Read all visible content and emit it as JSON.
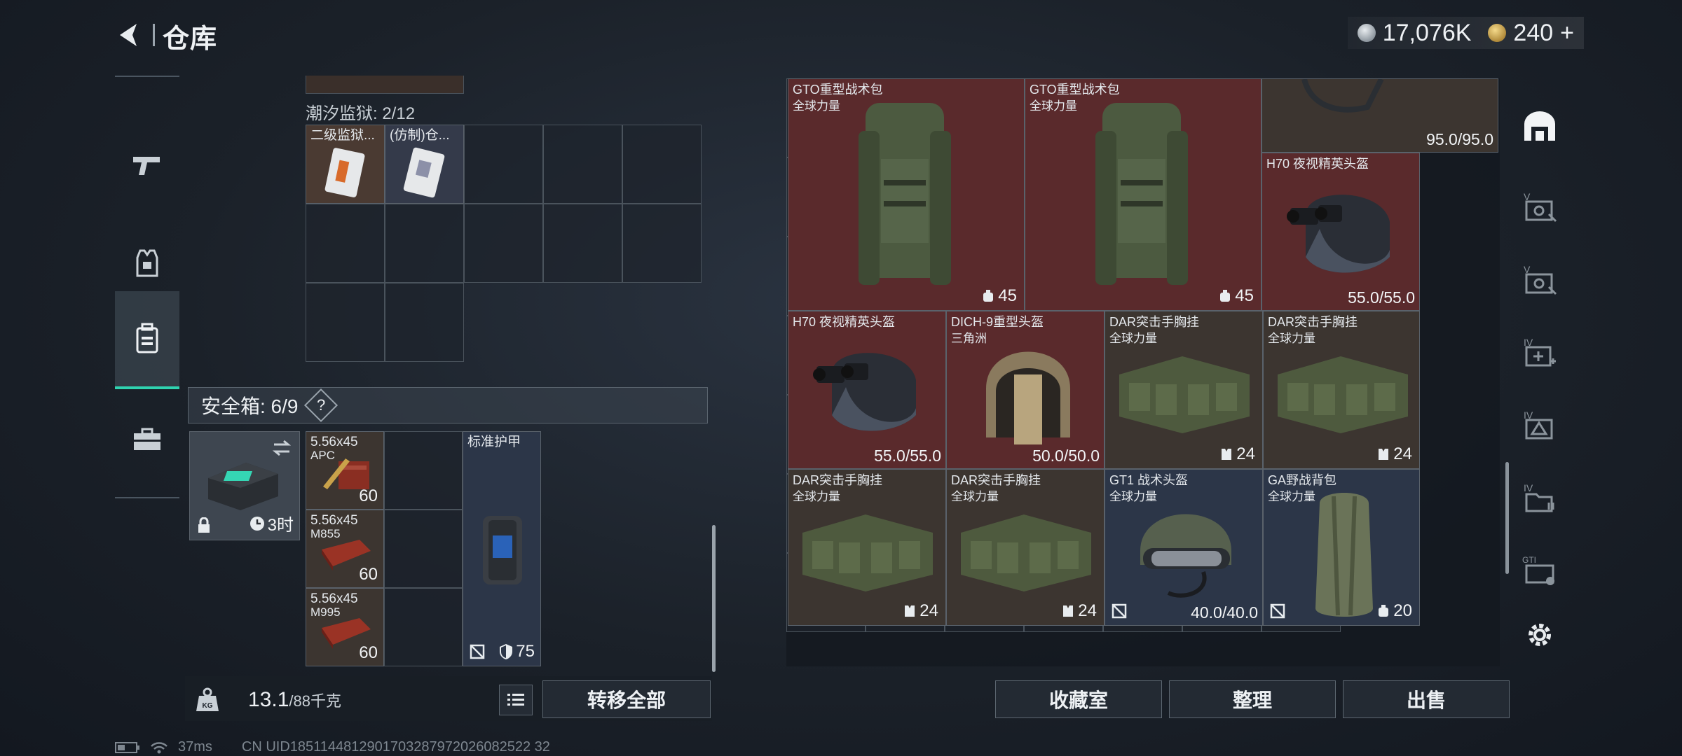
{
  "header": {
    "title": "仓库",
    "currency_primary": "17,076K",
    "currency_secondary": "240",
    "plus_label": "+"
  },
  "colors": {
    "accent": "#2fd3b0",
    "red_item_bg": "#5a2a2c",
    "brown_item_bg": "#3c3530",
    "blue_item_bg": "#2c3648"
  },
  "left_nav": {
    "items": [
      {
        "icon": "gun-icon"
      },
      {
        "icon": "armor-vest-icon"
      },
      {
        "icon": "backpack-icon",
        "active": true
      },
      {
        "icon": "briefcase-icon"
      }
    ]
  },
  "stash": {
    "label": "潮汐监狱: 2/12",
    "items": [
      {
        "name": "二级监狱...",
        "icon": "keycard-icon"
      },
      {
        "name": "(仿制)仓...",
        "icon": "keycard-icon"
      }
    ]
  },
  "safe_box": {
    "label": "安全箱: 6/9",
    "help": "?",
    "timer": "3时",
    "items": [
      {
        "name": "5.56x45",
        "sub": "APC",
        "count": "60"
      },
      {
        "name": "5.56x45",
        "sub": "M855",
        "count": "60"
      },
      {
        "name": "5.56x45",
        "sub": "M995",
        "count": "60"
      },
      {
        "name": "标准护甲",
        "durability": "75"
      }
    ]
  },
  "bottom_left": {
    "weight": "13.1",
    "weight_max": "/88千克",
    "transfer_all": "转移全部"
  },
  "right_items": [
    {
      "name": "GTO重型战术包",
      "sub": "全球力量",
      "badge": "45"
    },
    {
      "name": "GTO重型战术包",
      "sub": "全球力量",
      "badge": "45"
    },
    {
      "value": "95.0/95.0"
    },
    {
      "name": "H70 夜视精英头盔",
      "value": "55.0/55.0"
    },
    {
      "name": "H70 夜视精英头盔",
      "value": "55.0/55.0"
    },
    {
      "name": "DICH-9重型头盔",
      "sub": "三角洲",
      "value": "50.0/50.0"
    },
    {
      "name": "DAR突击手胸挂",
      "sub": "全球力量",
      "badge": "24"
    },
    {
      "name": "DAR突击手胸挂",
      "sub": "全球力量",
      "badge": "24"
    },
    {
      "name": "DAR突击手胸挂",
      "sub": "全球力量",
      "badge": "24"
    },
    {
      "name": "DAR突击手胸挂",
      "sub": "全球力量",
      "badge": "24"
    },
    {
      "name": "GT1 战术头盔",
      "sub": "全球力量",
      "value": "40.0/40.0"
    },
    {
      "name": "GA野战背包",
      "sub": "全球力量",
      "badge": "20"
    }
  ],
  "bottom_right": {
    "collection": "收藏室",
    "organize": "整理",
    "sell": "出售"
  },
  "right_nav": {
    "labels": [
      "V",
      "V",
      "IV",
      "IV",
      "IV",
      "GTI"
    ]
  },
  "status_bar": {
    "ping": "37ms",
    "uid": "CN UID1851144812901703287972026082522 32"
  }
}
